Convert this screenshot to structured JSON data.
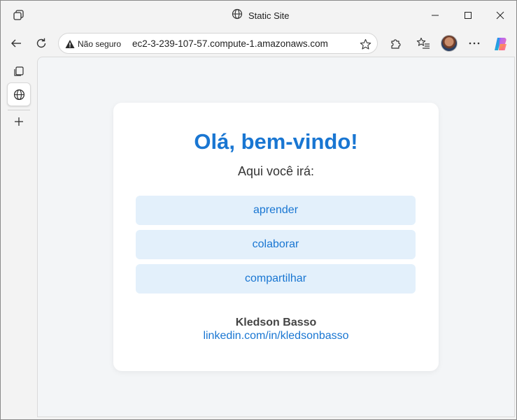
{
  "window": {
    "title": "Static Site"
  },
  "toolbar": {
    "security_label": "Não seguro",
    "url": "ec2-3-239-107-57.compute-1.amazonaws.com"
  },
  "page": {
    "greeting": "Olá, bem-vindo!",
    "subtitle": "Aqui você irá:",
    "actions": [
      {
        "label": "aprender"
      },
      {
        "label": "colaborar"
      },
      {
        "label": "compartilhar"
      }
    ],
    "author_name": "Kledson Basso",
    "author_link": "linkedin.com/in/kledsonbasso"
  },
  "colors": {
    "accent": "#1976d2",
    "action_bg": "#e3f0fb",
    "card_bg": "#ffffff",
    "page_bg": "#f3f5f7"
  },
  "icons": {
    "workspaces": "workspaces-icon",
    "site": "globe-icon",
    "back": "back-arrow-icon",
    "refresh": "refresh-icon",
    "warning": "warning-icon",
    "favorite": "star-icon",
    "extensions": "puzzle-icon",
    "favorites": "favorites-list-icon",
    "menu": "more-icon",
    "copilot": "copilot-icon",
    "new_tab": "plus-icon"
  }
}
